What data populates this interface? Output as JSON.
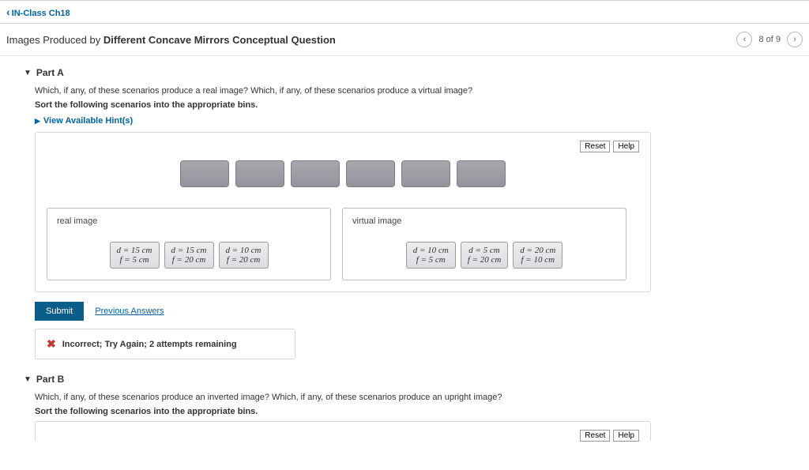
{
  "nav": {
    "back_label": "IN-Class Ch18"
  },
  "header": {
    "title_plain": "Images Produced by ",
    "title_bold": "Different Concave Mirrors Conceptual Question",
    "pager": "8 of 9"
  },
  "partA": {
    "label": "Part A",
    "prompt1": "Which, if any, of these scenarios produce a real image? Which, if any, of these scenarios produce a virtual image?",
    "prompt2": "Sort the following scenarios into the appropriate bins.",
    "hints": "View Available Hint(s)",
    "reset": "Reset",
    "help": "Help",
    "bin1_title": "real image",
    "bin2_title": "virtual image",
    "bin1_cards": [
      {
        "l1": "d = 15 cm",
        "l2": "f = 5 cm"
      },
      {
        "l1": "d = 15 cm",
        "l2": "f = 20 cm"
      },
      {
        "l1": "d = 10 cm",
        "l2": "f = 20 cm"
      }
    ],
    "bin2_cards": [
      {
        "l1": "d = 10 cm",
        "l2": "f = 5 cm"
      },
      {
        "l1": "d = 5 cm",
        "l2": "f = 20 cm"
      },
      {
        "l1": "d = 20 cm",
        "l2": "f = 10 cm"
      }
    ],
    "submit": "Submit",
    "prev_answers": "Previous Answers",
    "feedback": "Incorrect; Try Again; 2 attempts remaining"
  },
  "partB": {
    "label": "Part B",
    "prompt1": "Which, if any, of these scenarios produce an inverted image? Which, if any, of these scenarios produce an upright image?",
    "prompt2": "Sort the following scenarios into the appropriate bins.",
    "reset": "Reset",
    "help": "Help"
  }
}
